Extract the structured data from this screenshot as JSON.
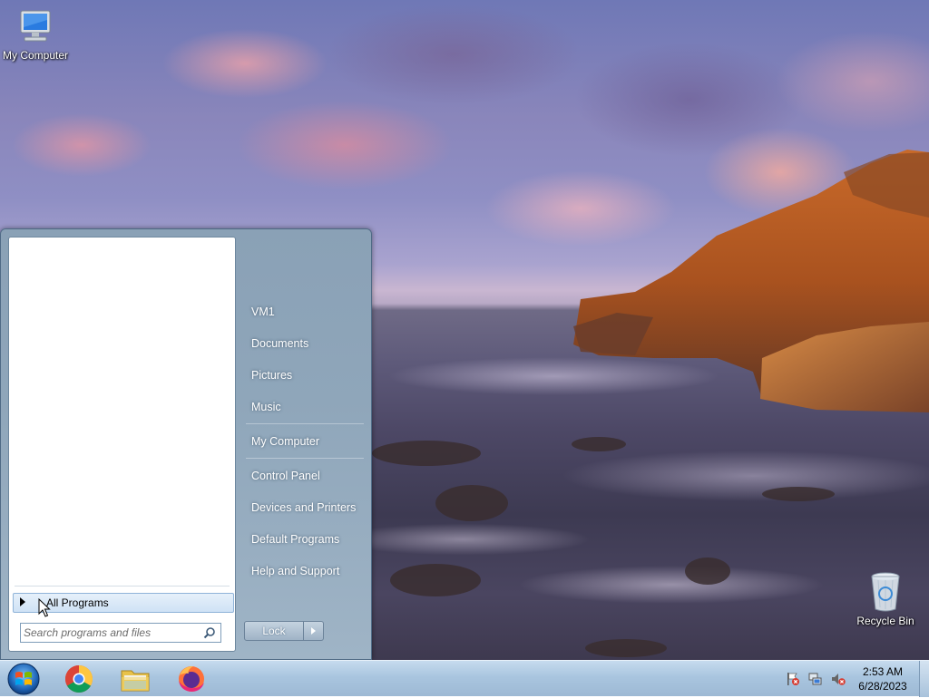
{
  "desktop": {
    "icons": [
      {
        "label": "My Computer",
        "icon": "computer-icon"
      },
      {
        "label": "Recycle Bin",
        "icon": "recycle-bin-icon"
      }
    ]
  },
  "start_menu": {
    "all_programs_label": "All Programs",
    "search_placeholder": "Search programs and files",
    "right_links": [
      "VM1",
      "Documents",
      "Pictures",
      "Music",
      "My Computer",
      "Control Panel",
      "Devices and Printers",
      "Default Programs",
      "Help and Support"
    ],
    "lock_label": "Lock"
  },
  "taskbar": {
    "pinned": [
      {
        "name": "Google Chrome",
        "icon": "chrome-icon"
      },
      {
        "name": "Windows Explorer",
        "icon": "file-explorer-icon"
      },
      {
        "name": "Firefox",
        "icon": "firefox-icon"
      }
    ],
    "tray_icons": [
      "action-center-flag-icon",
      "network-icon",
      "volume-muted-icon"
    ],
    "clock": {
      "time": "2:53 AM",
      "date": "6/28/2023"
    }
  },
  "colors": {
    "taskbar": "#a9c5df",
    "start_menu_right_pane": "#8fa6ba",
    "all_programs_highlight": "#cfe2f5"
  }
}
